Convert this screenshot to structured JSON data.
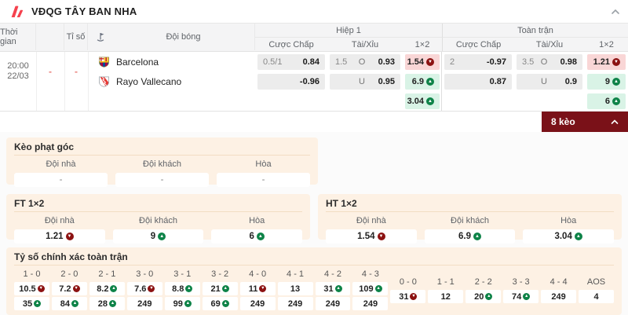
{
  "league": {
    "title": "VĐQG TÂY BAN NHA"
  },
  "table": {
    "col_time": "Thời gian",
    "col_score": "Tỉ số",
    "col_team": "Đội bóng",
    "group_half1": "Hiệp 1",
    "group_full": "Toàn trận",
    "col_handicap": "Cược Chấp",
    "col_ou": "Tài/Xỉu",
    "col_1x2": "1×2",
    "match": {
      "time": "20:00",
      "date": "22/03",
      "score_home": "-",
      "score_away": "-",
      "home_team": "Barcelona",
      "away_team": "Rayo Vallecano"
    },
    "h1": {
      "hc_line": "0.5/1",
      "hc_home": "0.84",
      "hc_away": "-0.96",
      "ou_line": "1.5",
      "over_label": "O",
      "over": "0.93",
      "under_label": "U",
      "under": "0.95",
      "x12": [
        {
          "v": "1.54",
          "trend": "down"
        },
        {
          "v": "6.9",
          "trend": "up"
        },
        {
          "v": "3.04",
          "trend": "up"
        }
      ]
    },
    "ft": {
      "hc_line": "2",
      "hc_home": "-0.97",
      "hc_away": "0.87",
      "ou_line": "3.5",
      "over_label": "O",
      "over": "0.98",
      "under_label": "U",
      "under": "0.9",
      "x12": [
        {
          "v": "1.21",
          "trend": "down"
        },
        {
          "v": "9",
          "trend": "up"
        },
        {
          "v": "6",
          "trend": "up"
        }
      ]
    },
    "more_bets_label": "8 kèo"
  },
  "corner_panel": {
    "title": "Kèo phạt góc",
    "columns": [
      "Đội nhà",
      "Đội khách",
      "Hòa"
    ],
    "values": [
      {
        "v": "-"
      },
      {
        "v": "-"
      },
      {
        "v": "-"
      }
    ]
  },
  "ft_panel": {
    "title": "FT 1×2",
    "columns": [
      "Đội nhà",
      "Đội khách",
      "Hòa"
    ],
    "values": [
      {
        "v": "1.21",
        "trend": "down"
      },
      {
        "v": "9",
        "trend": "up"
      },
      {
        "v": "6",
        "trend": "up"
      }
    ]
  },
  "ht_panel": {
    "title": "HT 1×2",
    "columns": [
      "Đội nhà",
      "Đội khách",
      "Hòa"
    ],
    "values": [
      {
        "v": "1.54",
        "trend": "down"
      },
      {
        "v": "6.9",
        "trend": "up"
      },
      {
        "v": "3.04",
        "trend": "up"
      }
    ]
  },
  "correct_score_panel": {
    "title": "Tỷ số chính xác toàn trận",
    "main_columns": [
      {
        "score": "1 - 0",
        "top": {
          "v": "10.5",
          "trend": "down"
        },
        "bottom": {
          "v": "35",
          "trend": "up"
        }
      },
      {
        "score": "2 - 0",
        "top": {
          "v": "7.2",
          "trend": "down"
        },
        "bottom": {
          "v": "84",
          "trend": "up"
        }
      },
      {
        "score": "2 - 1",
        "top": {
          "v": "8.2",
          "trend": "up"
        },
        "bottom": {
          "v": "28",
          "trend": "up"
        }
      },
      {
        "score": "3 - 0",
        "top": {
          "v": "7.6",
          "trend": "down"
        },
        "bottom": {
          "v": "249"
        }
      },
      {
        "score": "3 - 1",
        "top": {
          "v": "8.8",
          "trend": "up"
        },
        "bottom": {
          "v": "99",
          "trend": "up"
        }
      },
      {
        "score": "3 - 2",
        "top": {
          "v": "21",
          "trend": "up"
        },
        "bottom": {
          "v": "69",
          "trend": "up"
        }
      },
      {
        "score": "4 - 0",
        "top": {
          "v": "11",
          "trend": "down"
        },
        "bottom": {
          "v": "249"
        }
      },
      {
        "score": "4 - 1",
        "top": {
          "v": "13"
        },
        "bottom": {
          "v": "249"
        }
      },
      {
        "score": "4 - 2",
        "top": {
          "v": "31",
          "trend": "up"
        },
        "bottom": {
          "v": "249"
        }
      },
      {
        "score": "4 - 3",
        "top": {
          "v": "109",
          "trend": "up"
        },
        "bottom": {
          "v": "249"
        }
      }
    ],
    "draw_columns": [
      {
        "score": "0 - 0",
        "value": {
          "v": "31",
          "trend": "down"
        }
      },
      {
        "score": "1 - 1",
        "value": {
          "v": "12"
        }
      },
      {
        "score": "2 - 2",
        "value": {
          "v": "20",
          "trend": "up"
        }
      },
      {
        "score": "3 - 3",
        "value": {
          "v": "74",
          "trend": "up"
        }
      },
      {
        "score": "4 - 4",
        "value": {
          "v": "249"
        }
      },
      {
        "score": "AOS",
        "value": {
          "v": "4"
        }
      }
    ]
  },
  "colors": {
    "accent_red": "#f5424e",
    "badge_bg": "#7a1118",
    "up_bg": "#d9f3e6",
    "down_bg": "#f9d6d6",
    "up_icon": "#0e8348",
    "down_icon": "#8c1212",
    "panel_bg": "#fdf1e4"
  }
}
